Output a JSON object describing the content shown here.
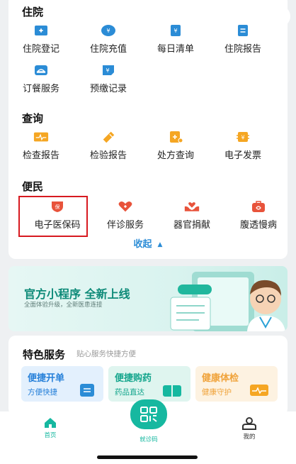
{
  "top_controls": {
    "more_icon": "more-dots-icon",
    "record_icon": "record-icon"
  },
  "sections": {
    "inpatient": {
      "title": "住院",
      "items": [
        {
          "label": "住院登记",
          "icon": "plus-card-icon"
        },
        {
          "label": "住院充值",
          "icon": "yen-shield-icon"
        },
        {
          "label": "每日清单",
          "icon": "yen-doc-icon"
        },
        {
          "label": "住院报告",
          "icon": "list-doc-icon"
        },
        {
          "label": "订餐服务",
          "icon": "meal-bowl-icon"
        },
        {
          "label": "预缴记录",
          "icon": "yen-note-icon"
        }
      ]
    },
    "query": {
      "title": "查询",
      "items": [
        {
          "label": "检查报告",
          "icon": "ecg-icon"
        },
        {
          "label": "检验报告",
          "icon": "test-tube-icon"
        },
        {
          "label": "处方查询",
          "icon": "prescription-icon"
        },
        {
          "label": "电子发票",
          "icon": "invoice-icon"
        }
      ]
    },
    "convenience": {
      "title": "便民",
      "items": [
        {
          "label": "电子医保码",
          "icon": "insurance-shield-icon",
          "badge": "保"
        },
        {
          "label": "伴诊服务",
          "icon": "companion-heart-icon"
        },
        {
          "label": "器官捐献",
          "icon": "donation-hands-icon"
        },
        {
          "label": "腹透慢病",
          "icon": "medical-kit-icon"
        }
      ]
    },
    "collapse_label": "收起"
  },
  "banner": {
    "title": "官方小程序  全新上线",
    "subtitle": "全面体验升级，全新医患连接"
  },
  "featured": {
    "title": "特色服务",
    "subtitle": "贴心服务快捷方便",
    "tiles": [
      {
        "title": "便捷开单",
        "sub": "方便快捷",
        "title_color": "#2680d9",
        "sub_color": "#2680d9",
        "bg": "#e3f0fd"
      },
      {
        "title": "便捷购药",
        "sub": "药品直达",
        "title_color": "#13a58c",
        "sub_color": "#13a58c",
        "bg": "#dff5ef"
      },
      {
        "title": "健康体检",
        "sub": "健康守护",
        "title_color": "#f0a33b",
        "sub_color": "#f0a33b",
        "bg": "#fdf2e1"
      }
    ]
  },
  "tabbar": {
    "home": "首页",
    "visit_code": "就诊码",
    "mine": "我的"
  },
  "colors": {
    "blue": "#2b8cd6",
    "teal": "#16b8a0",
    "orange": "#f5a623",
    "red": "#e8533b",
    "highlight": "#d71920"
  }
}
